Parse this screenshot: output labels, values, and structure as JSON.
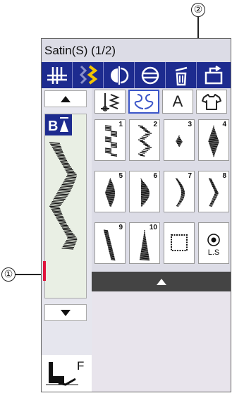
{
  "callouts": {
    "one": "①",
    "two": "②"
  },
  "screen": {
    "title": "Satin(S) (1/2)",
    "toolbar": [
      "needle-position-icon",
      "twin-needle-icon",
      "mirror-image-icon",
      "elongation-icon",
      "delete-icon",
      "return-icon"
    ],
    "tabs": [
      "stitch-category-icon",
      "satin-pattern-icon",
      "letter-a",
      "garment-icon"
    ],
    "tab_letter": "A",
    "active_tab_index": 1,
    "preview_badge": "B▼",
    "foot_letter": "F",
    "patterns": [
      {
        "num": "1",
        "shape": "zigzag-satin-double"
      },
      {
        "num": "2",
        "shape": "zigzag-satin"
      },
      {
        "num": "3",
        "shape": "small-diamond"
      },
      {
        "num": "4",
        "shape": "long-diamond"
      },
      {
        "num": "5",
        "shape": "half-leaf"
      },
      {
        "num": "6",
        "shape": "half-moon"
      },
      {
        "num": "7",
        "shape": "crescent"
      },
      {
        "num": "8",
        "shape": "chevron"
      },
      {
        "num": "9",
        "shape": "slanted-bar"
      },
      {
        "num": "10",
        "shape": "triangle"
      },
      {
        "num": "",
        "shape": "dotted-square"
      },
      {
        "num": "",
        "shape": "lock-stitch",
        "label": "L.S"
      }
    ]
  }
}
